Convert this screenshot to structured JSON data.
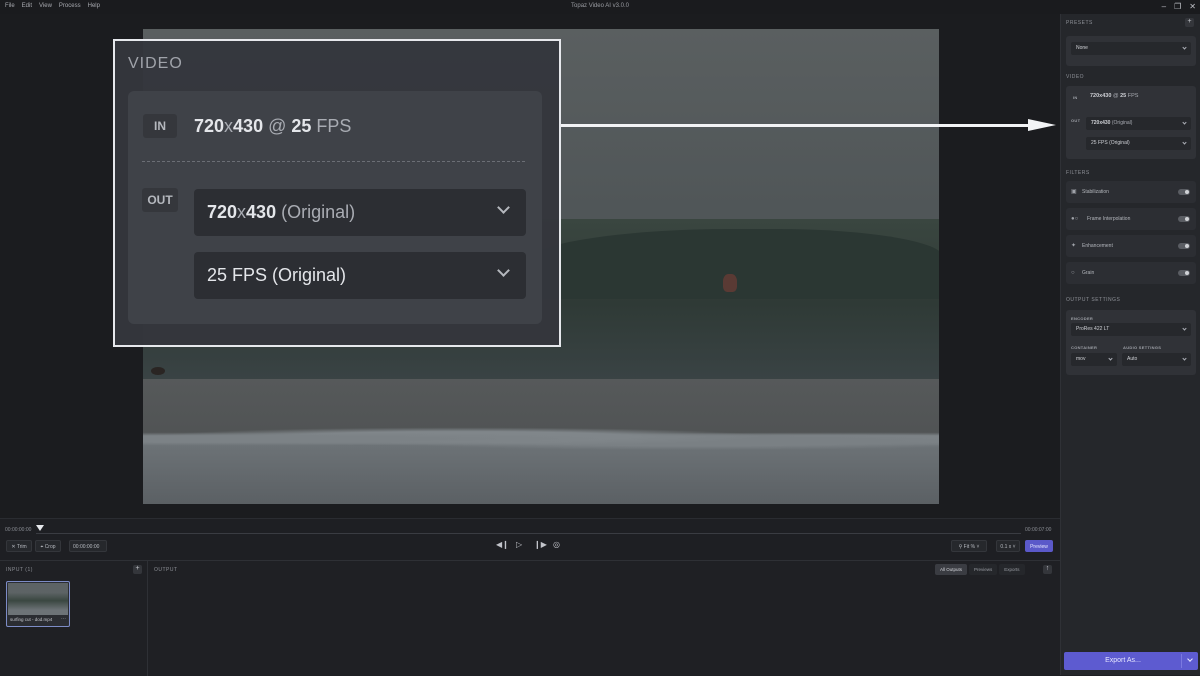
{
  "titlebar": {
    "menu": [
      "File",
      "Edit",
      "View",
      "Process",
      "Help"
    ],
    "title": "Topaz Video AI  v3.0.0",
    "controls": [
      "minimize-icon",
      "restore-icon",
      "close-icon"
    ]
  },
  "zoom_callout": {
    "heading": "VIDEO",
    "in_badge": "IN",
    "in_res_w": "720",
    "in_res_x": "x",
    "in_res_h": "430",
    "in_at": " @ ",
    "in_fps": "25",
    "in_fps_unit": " FPS",
    "out_badge": "OUT",
    "out_res_w": "720",
    "out_res_x": "x",
    "out_res_h": "430",
    "out_res_note": " (Original)",
    "out_fps": "25 FPS (Original)"
  },
  "timeline": {
    "start_time": "00:00:00:00",
    "end_time": "00:00:07:00",
    "trim_label": "Trim",
    "crop_label": "Crop",
    "timecode": "00:00:00:00",
    "zoom_label": "Fit %",
    "speed_label": "0.1 x",
    "preview_label": "Preview",
    "transport": [
      "step-back-icon",
      "play-icon",
      "step-forward-icon",
      "loop-icon"
    ]
  },
  "input_pane": {
    "label": "INPUT (1)",
    "file_name": "surfing cut - dod.mp4"
  },
  "output_pane": {
    "label": "OUTPUT",
    "tabs": [
      "All Outputs",
      "Previews",
      "Exports"
    ],
    "active_tab": 0
  },
  "panel": {
    "presets_label": "PRESETS",
    "preset_value": "None",
    "video_label": "VIDEO",
    "in_badge": "IN",
    "in_res": "720x430",
    "in_at": " @ ",
    "in_fps": "25",
    "in_fps_unit": " FPS",
    "out_badge": "OUT",
    "out_res": "720x430",
    "out_res_note": " (Original)",
    "out_fps": "25 FPS (Original)",
    "filters_label": "FILTERS",
    "filters": [
      {
        "label": "Stabilization",
        "icon": "stabilization-icon",
        "enabled": false
      },
      {
        "label": "Frame Interpolation",
        "icon": "frame-interpolation-icon",
        "enabled": false
      },
      {
        "label": "Enhancement",
        "icon": "enhancement-icon",
        "enabled": false
      },
      {
        "label": "Grain",
        "icon": "grain-icon",
        "enabled": false
      }
    ],
    "output_settings_label": "OUTPUT SETTINGS",
    "encoder_label": "ENCODER",
    "encoder_value": "ProRes 422 LT",
    "container_label": "CONTAINER",
    "container_value": "mov",
    "audio_label": "AUDIO SETTINGS",
    "audio_value": "Auto",
    "export_label": "Export As..."
  },
  "colors": {
    "accent": "#5d5bd0",
    "background": "#1e1f23",
    "panel": "#25272b"
  }
}
